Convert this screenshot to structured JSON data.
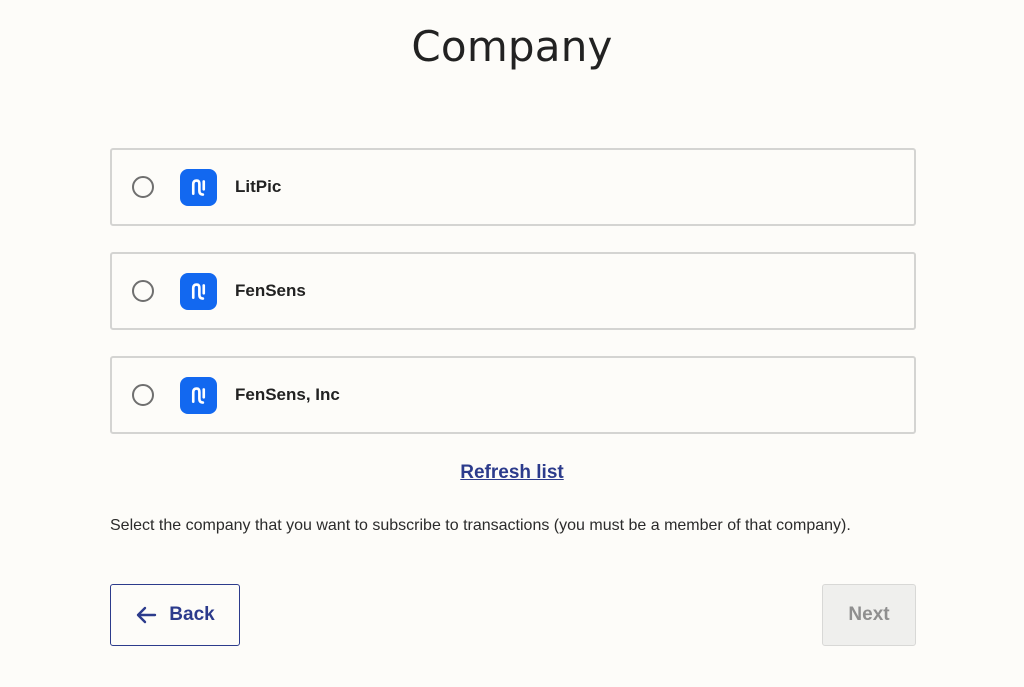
{
  "page": {
    "title": "Company"
  },
  "companies": [
    {
      "name": "LitPic",
      "icon": "app-logo-icon",
      "selected": false
    },
    {
      "name": "FenSens",
      "icon": "app-logo-icon",
      "selected": false
    },
    {
      "name": "FenSens, Inc",
      "icon": "app-logo-icon",
      "selected": false
    }
  ],
  "refresh_label": "Refresh list",
  "helper_text": "Select the company that you want to subscribe to transactions (you must be a member of that company).",
  "buttons": {
    "back_label": "Back",
    "back_icon": "arrow-left-icon",
    "next_label": "Next",
    "next_disabled": true
  },
  "colors": {
    "accent": "#2c3b8c",
    "app_icon": "#1268f0",
    "background": "#fdfcf9",
    "disabled": "#8f8f8f"
  }
}
